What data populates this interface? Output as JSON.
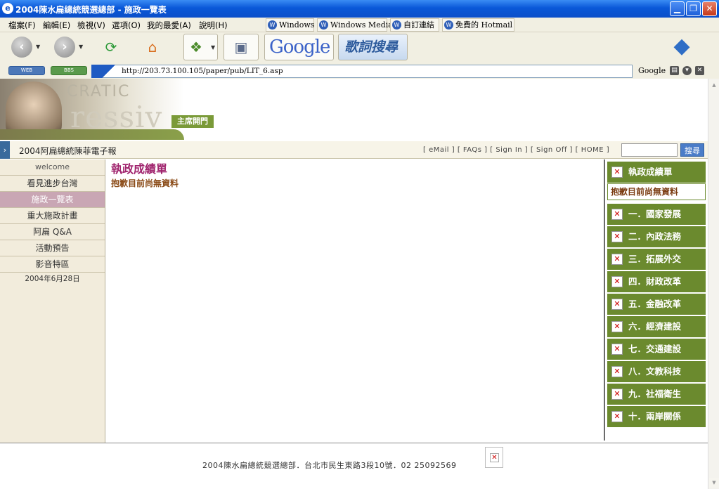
{
  "window": {
    "title": "2004陳水扁總統競選總部 - 施政一覽表",
    "minimize": "▁",
    "maximize": "❐",
    "close": "✕"
  },
  "menu": {
    "items": [
      "檔案(F)",
      "編輯(E)",
      "檢視(V)",
      "選項(O)",
      "我的最愛(A)",
      "說明(H)"
    ],
    "links": [
      "Windows",
      "Windows Media",
      "自訂連結",
      "免費的 Hotmail"
    ]
  },
  "toolbar": {
    "google_logo": "Google",
    "lyrics_search": "歌詞搜尋",
    "icons": [
      "back-icon",
      "forward-icon",
      "refresh-icon",
      "home-icon",
      "shopping-icon",
      "package-icon",
      "brand-cube-icon"
    ]
  },
  "address": {
    "web_label": "WEB",
    "bbs_label": "BBS",
    "url": "http://203.73.100.105/paper/pub/LIT_6.asp",
    "google_label": "Google"
  },
  "banner": {
    "slogan1": "CRATIC",
    "slogan2": "ressiv",
    "home_button": "主席開門"
  },
  "sitebar": {
    "title": "2004阿扁總統陳菲電子報",
    "links": [
      "[ eMail ]",
      "[ FAQs ]",
      "[ Sign In ]",
      "[ Sign Off ]",
      "[ HOME ]"
    ],
    "search_button": "搜尋"
  },
  "leftnav": {
    "welcome": "welcome",
    "items": [
      "看見進步台灣",
      "施政一覽表",
      "重大施政計畫",
      "阿扁 Q&A",
      "活動預告",
      "影音特區"
    ],
    "active_index": 1,
    "date": "2004年6月28日"
  },
  "main": {
    "heading": "執政成績單",
    "message": "抱歉目前尚無資料"
  },
  "rightcol": {
    "header": "執政成績單",
    "nodata": "抱歉目前尚無資料",
    "categories": [
      "一．國家發展",
      "二．內政法務",
      "三．拓展外交",
      "四．財政改革",
      "五．金融改革",
      "六．經濟建設",
      "七．交通建設",
      "八．文教科技",
      "九．社福衛生",
      "十．兩岸關係"
    ]
  },
  "footer": {
    "text": "2004陳水扁總統競選總部．台北市民生東路3段10號．02 25092569"
  },
  "colors": {
    "nav_active": "#c9a6b4",
    "category_green": "#6b8a2e",
    "heading_magenta": "#a0246e",
    "titlebar_blue": "#0a58d8"
  }
}
